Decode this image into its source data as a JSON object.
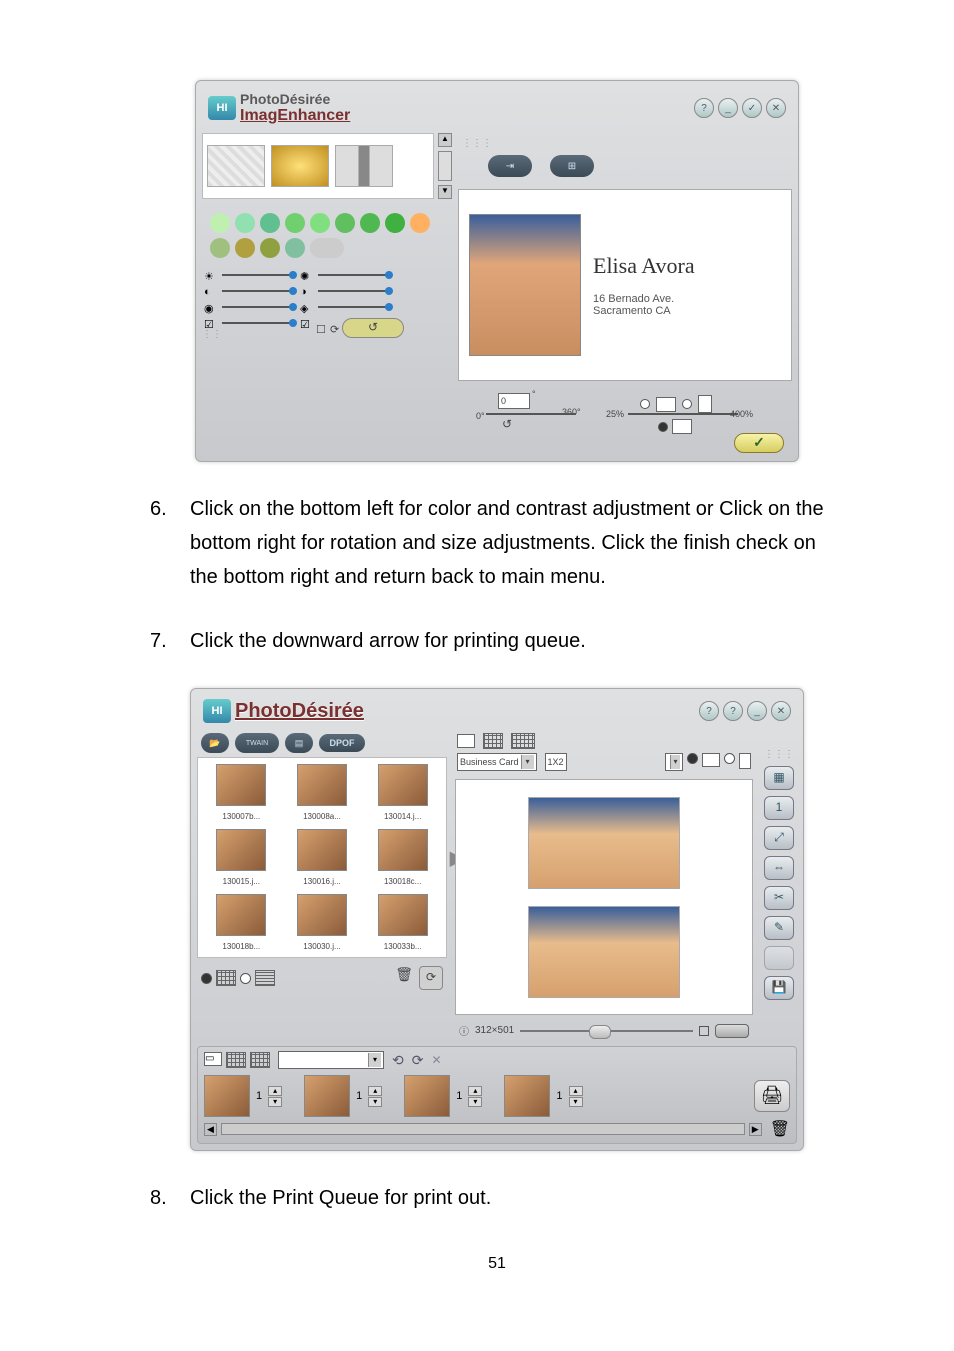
{
  "screenshot1": {
    "app_title_top": "PhotoDésirée",
    "app_title_main": "ImagEnhancer",
    "logo_badge": "HI",
    "titlebar_buttons": {
      "help": "?",
      "minimize": "_",
      "confirm": "✓",
      "close": "✕"
    },
    "tabs": {
      "single": "⇥",
      "contact": "⊞"
    },
    "scrollbar": {
      "up": "▲",
      "down": "▼"
    },
    "card": {
      "name": "Elisa Avora",
      "addr1": "16 Bernado Ave.",
      "addr2": "Sacramento CA"
    },
    "rotation": {
      "value": "0",
      "deg": "°",
      "left_end": "0°",
      "right_end": "360°",
      "dial": "↺"
    },
    "size": {
      "left_end": "25%",
      "right_end": "400%"
    },
    "undo": "↺",
    "lock_label": "⟳",
    "finish": "✓"
  },
  "step6": {
    "num": "6.",
    "text": "Click on the bottom left for color and contrast adjustment or Click on the bottom right for rotation and size adjustments.    Click the finish check on the bottom right and return back to main menu."
  },
  "step7": {
    "num": "7.",
    "text": "Click the downward arrow for printing queue."
  },
  "screenshot2": {
    "app_title": "PhotoDésirée",
    "logo_badge": "HI",
    "titlebar_buttons": {
      "help": "?",
      "help2": "?",
      "minimize": "_",
      "close": "✕"
    },
    "toolbar": {
      "open": "📂",
      "twain": "TWAIN",
      "device": "▤",
      "dpof": "DPOF"
    },
    "combo_template": {
      "label": "Business Card"
    },
    "combo_layout": {
      "label": "1X2"
    },
    "thumbs": [
      {
        "fn": "130007b..."
      },
      {
        "fn": "130008a..."
      },
      {
        "fn": "130014.j..."
      },
      {
        "fn": "130015.j..."
      },
      {
        "fn": "130016.j..."
      },
      {
        "fn": "130018c..."
      },
      {
        "fn": "130018b..."
      },
      {
        "fn": "130030.j..."
      },
      {
        "fn": "130033b..."
      }
    ],
    "forward_arrow": "▶",
    "preview_dims": "312×501",
    "info_icon": "ⓘ",
    "left_buttons": {
      "trash": "🗑",
      "rotate": "⟳"
    },
    "side_buttons": {
      "palette": "▦",
      "one": "1",
      "fit": "⤢",
      "fitw": "⇔",
      "crop": "✂",
      "edit": "✎",
      "blank": "",
      "save": "💾"
    },
    "queue": {
      "layout_icons": {
        "single": "▭",
        "grid": "⊞",
        "grid2": "⊞"
      },
      "dropdown_arrow": "▾",
      "rotate_icons": {
        "left": "⟲",
        "right": "⟳",
        "flip": "✕"
      },
      "items": [
        {
          "copies": "1"
        },
        {
          "copies": "1"
        },
        {
          "copies": "1"
        },
        {
          "copies": "1"
        }
      ],
      "print": "🖨",
      "trash": "🗑",
      "scroll": {
        "left": "◀",
        "right": "▶"
      }
    }
  },
  "step8": {
    "num": "8.",
    "text": "Click the Print Queue for print out."
  },
  "page_number": "51"
}
